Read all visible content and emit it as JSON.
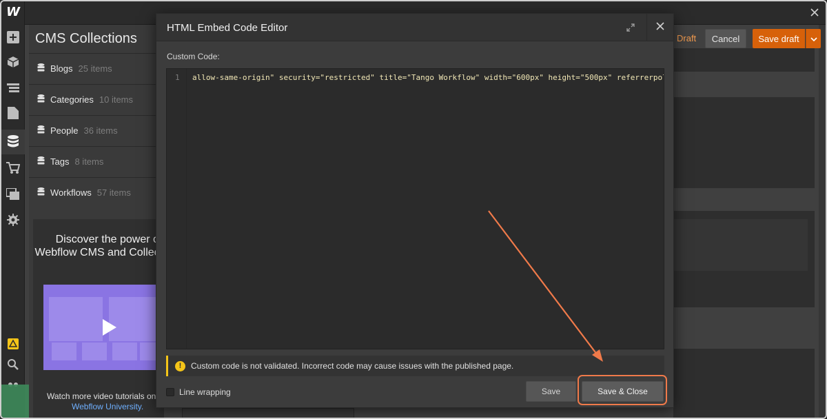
{
  "app": {
    "logo": "W"
  },
  "cms": {
    "title": "CMS Collections",
    "collections": [
      {
        "name": "Blogs",
        "count": "25 items"
      },
      {
        "name": "Categories",
        "count": "10 items"
      },
      {
        "name": "People",
        "count": "36 items"
      },
      {
        "name": "Tags",
        "count": "8 items"
      },
      {
        "name": "Workflows",
        "count": "57 items"
      }
    ],
    "promo": {
      "title": "Discover the power of Webflow CMS and Collections",
      "footer_text": "Watch more video tutorials on",
      "footer_link": "Webflow University."
    }
  },
  "toolbar": {
    "status": "Draft",
    "cancel_label": "Cancel",
    "save_draft_label": "Save draft"
  },
  "modal": {
    "title": "HTML Embed Code Editor",
    "custom_code_label": "Custom Code:",
    "line_number": "1",
    "code_line": "allow-same-origin\" security=\"restricted\" title=\"Tango Workflow\" width=\"600px\" height=\"500px\" referrerpolicy=\"s",
    "warning_text": "Custom code is not validated. Incorrect code may cause issues with the published page.",
    "line_wrapping_label": "Line wrapping",
    "save_label": "Save",
    "save_close_label": "Save & Close"
  },
  "colors": {
    "accent": "#d7610a",
    "annotation": "#f07a4a",
    "warning": "#f5c518",
    "video_bg": "#8a74e3"
  }
}
